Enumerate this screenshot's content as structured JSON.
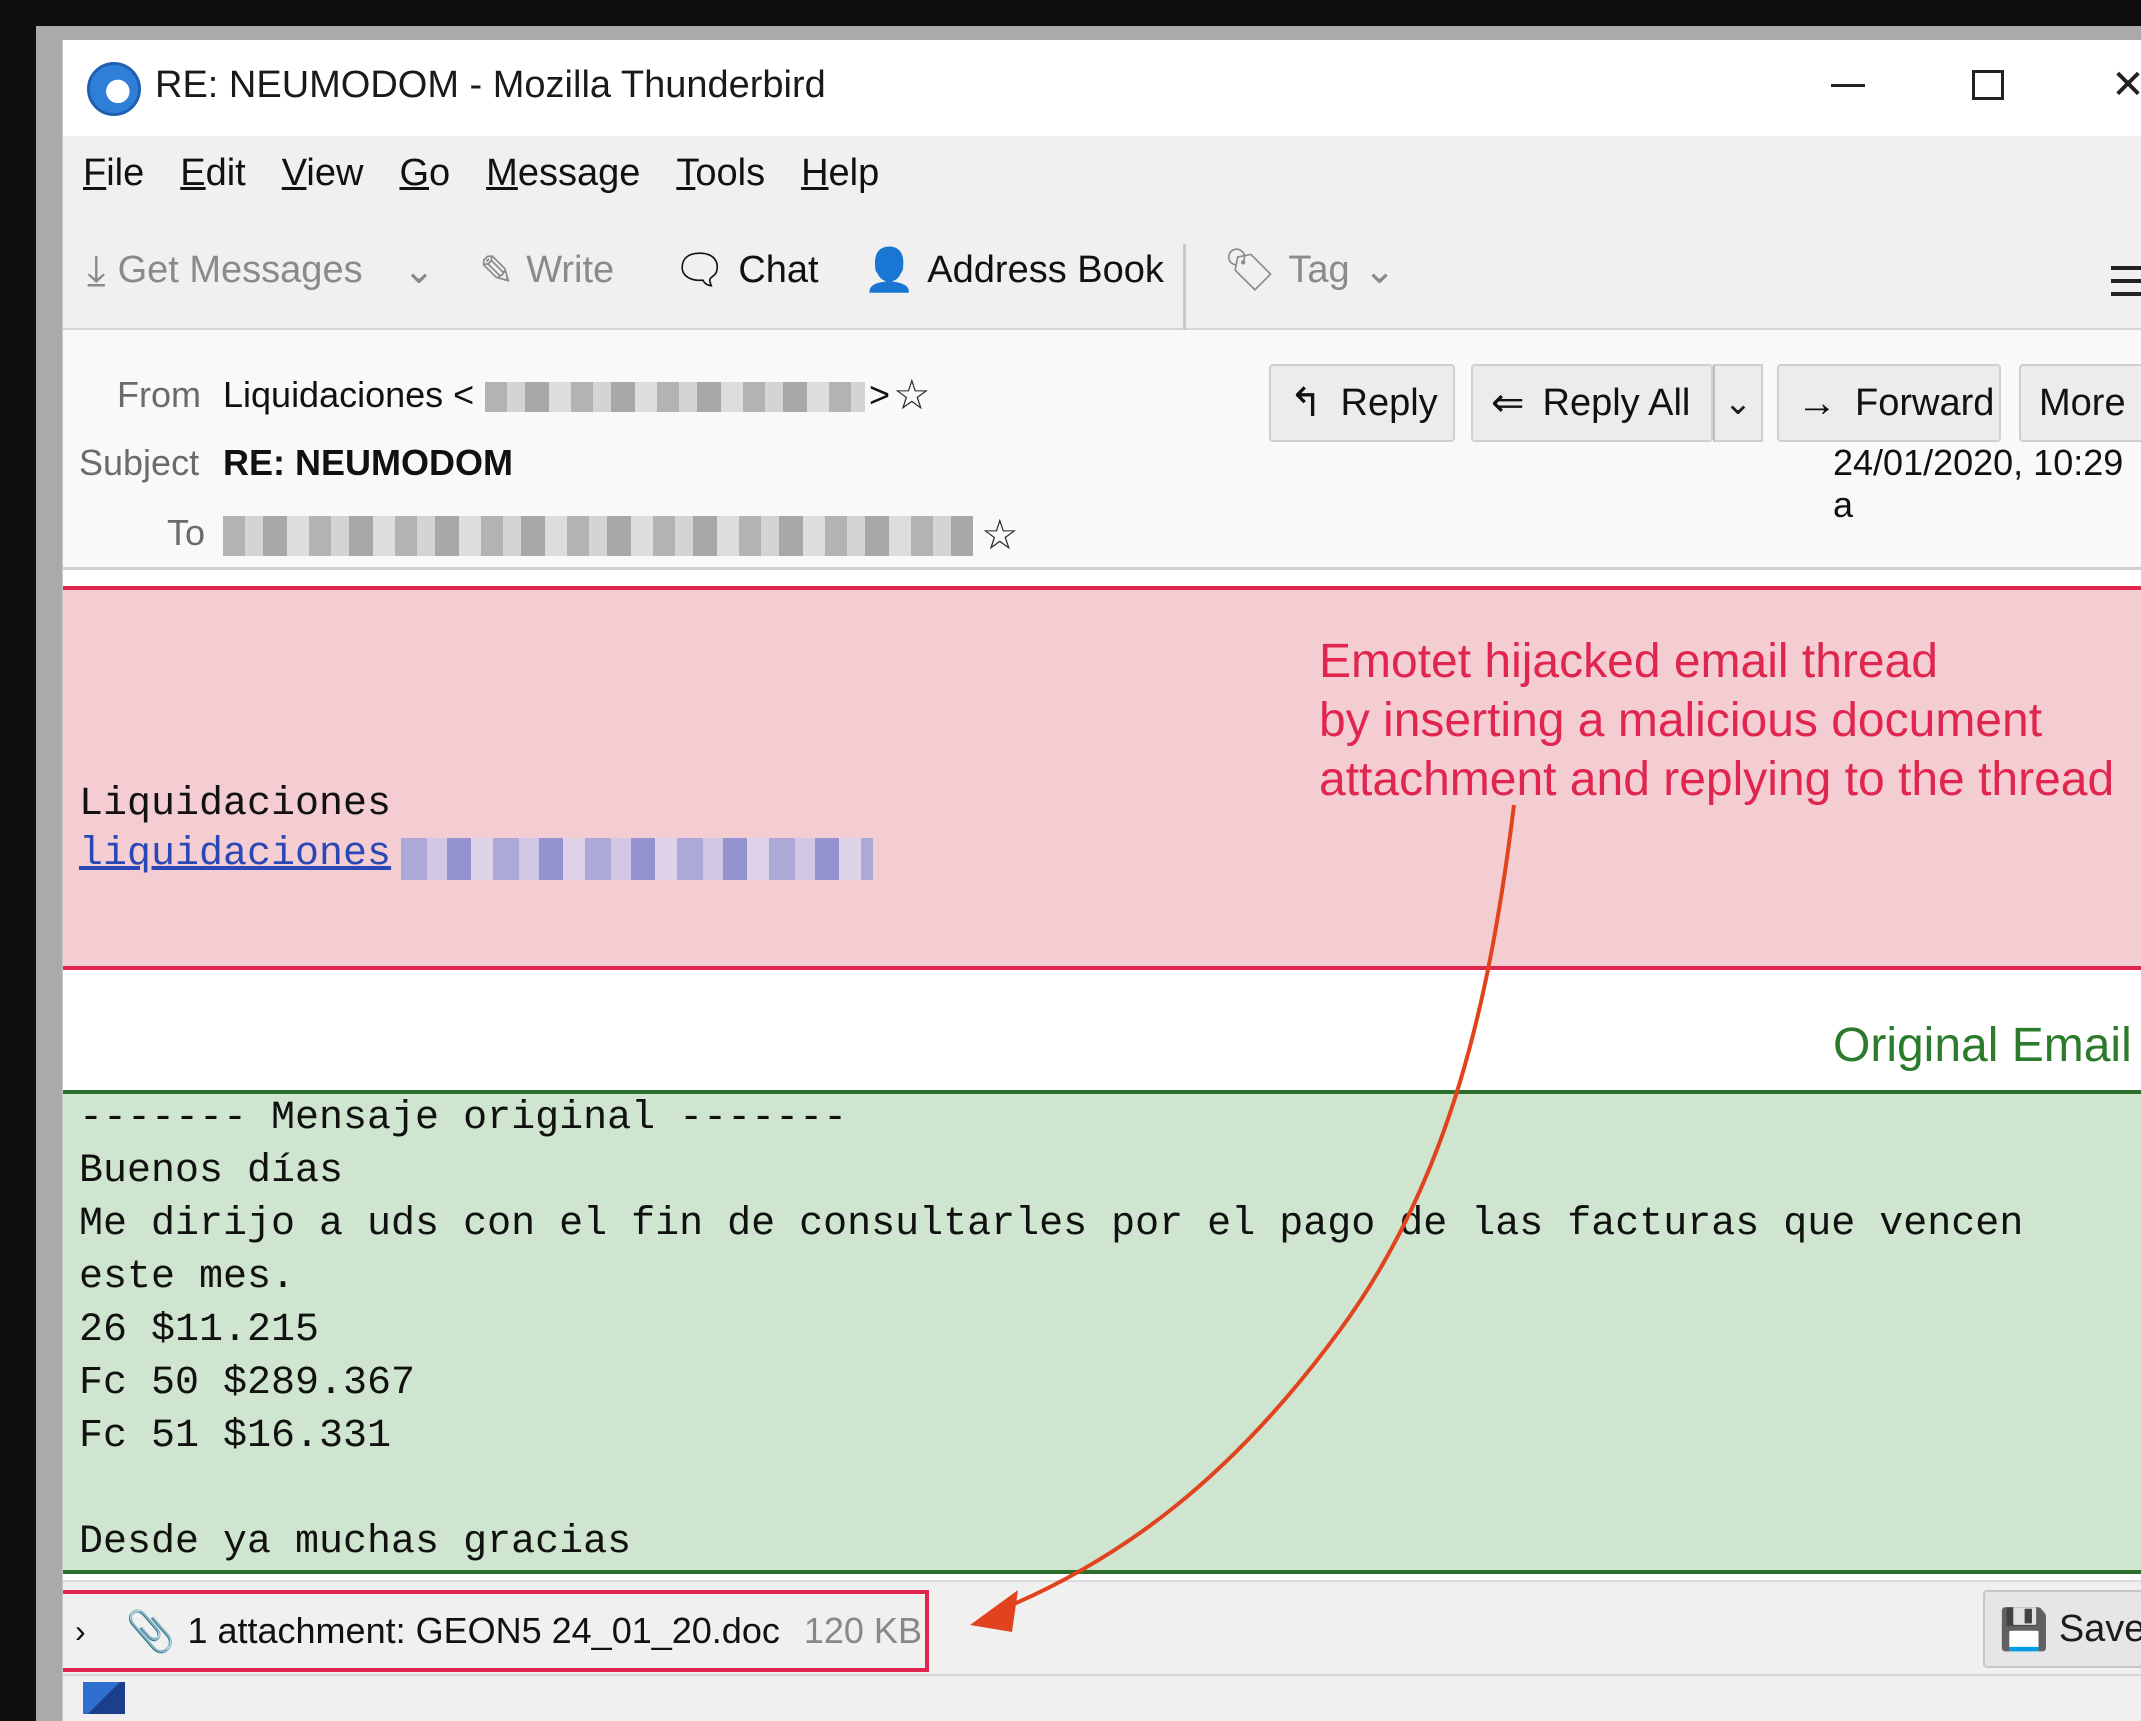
{
  "window": {
    "title": "RE: NEUMODOM - Mozilla Thunderbird"
  },
  "menubar": {
    "items": [
      {
        "ul": "F",
        "rest": "ile"
      },
      {
        "ul": "E",
        "rest": "dit"
      },
      {
        "ul": "V",
        "rest": "iew"
      },
      {
        "ul": "G",
        "rest": "o"
      },
      {
        "ul": "M",
        "rest": "essage"
      },
      {
        "ul": "T",
        "rest": "ools"
      },
      {
        "ul": "H",
        "rest": "elp"
      }
    ]
  },
  "toolbar": {
    "get_messages": "Get Messages",
    "write": "Write",
    "chat": "Chat",
    "address_book": "Address Book",
    "tag": "Tag"
  },
  "header": {
    "from_label": "From",
    "from_name": "Liquidaciones <",
    "from_end": ">",
    "subject_label": "Subject",
    "subject": "RE: NEUMODOM",
    "to_label": "To",
    "date": "24/01/2020, 10:29 a",
    "buttons": {
      "reply": "Reply",
      "reply_all": "Reply All",
      "forward": "Forward",
      "more": "More"
    }
  },
  "body": {
    "signature_name": "Liquidaciones",
    "signature_link": "liquidaciones",
    "annotation_red": "Emotet hijacked email thread\nby inserting a malicious document\nattachment and replying to the thread",
    "annotation_green": "Original Email",
    "original_lines": [
      "------- Mensaje original -------",
      "Buenos días",
      "Me dirijo a uds con el fin de consultarles por el pago de las facturas que vencen",
      "este mes.",
      "26 $11.215",
      "Fc 50 $289.367",
      "Fc 51 $16.331",
      "",
      "Desde ya muchas gracias"
    ]
  },
  "attachment": {
    "text": "1 attachment: GEON5 24_01_20.doc",
    "size": "120 KB",
    "save_label": "Save"
  },
  "colors": {
    "annotation_red": "#e0264f",
    "annotation_green": "#2c7a2c",
    "red_box_fill": "#f4cdd3",
    "green_box_fill": "#cfe5cf",
    "arrow": "#e2431f"
  },
  "icons": {
    "app": "thunderbird-icon",
    "get_messages": "download-icon",
    "write": "pencil-icon",
    "chat": "chat-bubble-icon",
    "address_book": "person-icon",
    "tag": "tag-icon",
    "reply": "reply-arrow-icon",
    "reply_all": "reply-all-arrow-icon",
    "forward": "forward-arrow-icon",
    "attachment": "paperclip-icon",
    "save": "floppy-disk-icon"
  }
}
